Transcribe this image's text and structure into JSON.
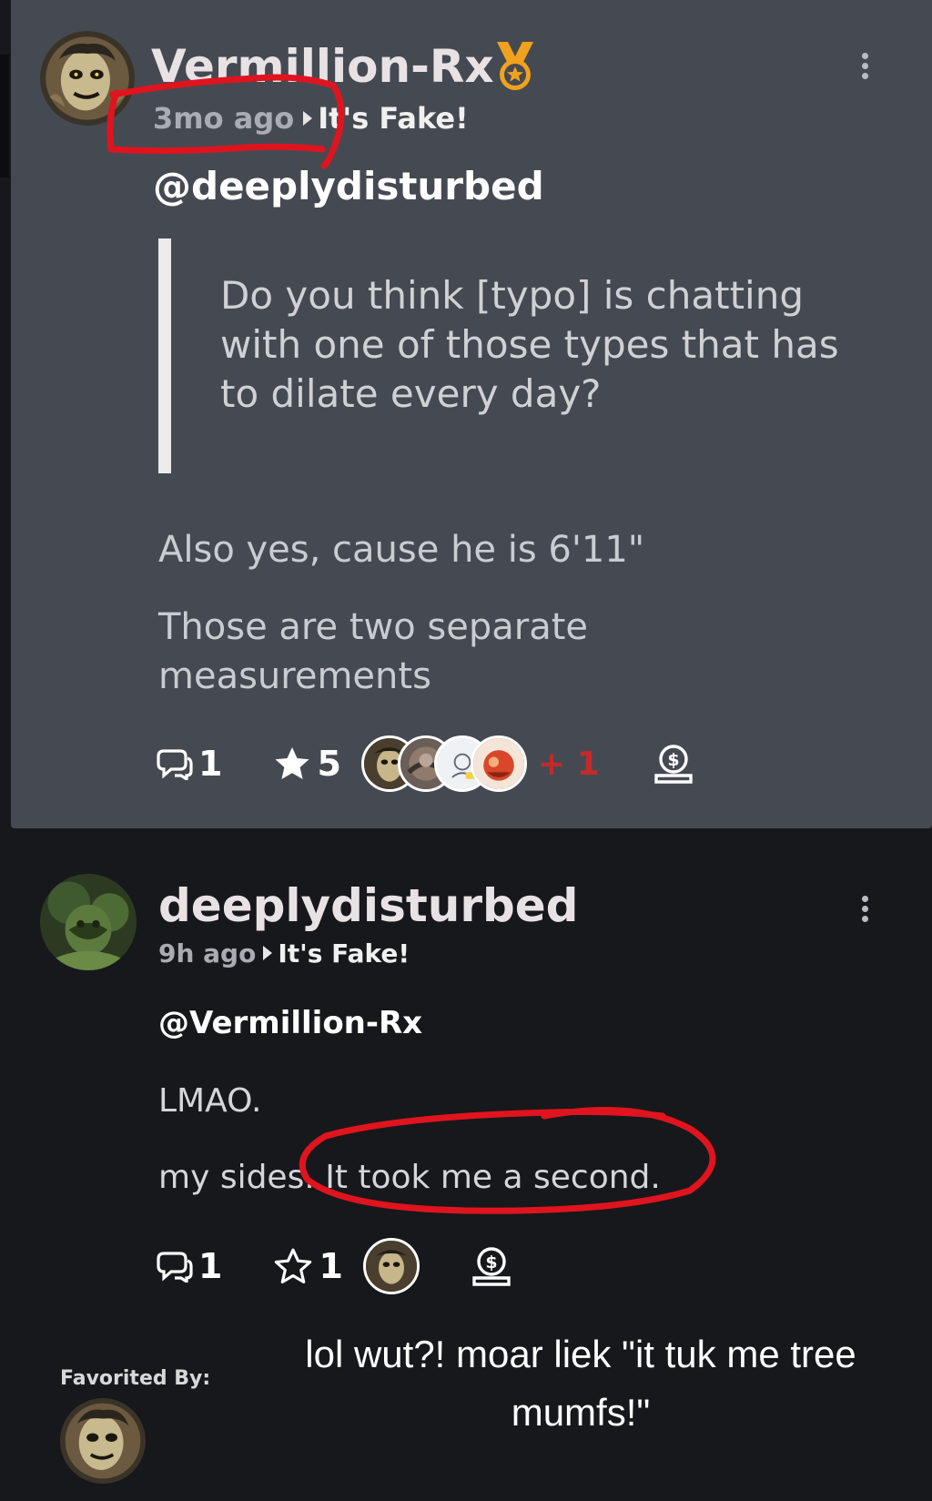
{
  "post1": {
    "username": "Vermillion-Rx",
    "badge_icon": "medal-icon",
    "time": "3mo ago",
    "channel": "It's Fake!",
    "mention": "@deeplydisturbed",
    "quote": "Do you think [typo] is chatting with one of those types that has to dilate every day?",
    "paragraph1": "Also yes, cause he is 6'11\"",
    "paragraph2": "Those are two separate measurements",
    "reply_count": "1",
    "favorite_count": "5",
    "more_favoriters": "+ 1"
  },
  "post2": {
    "username": "deeplydisturbed",
    "time": "9h ago",
    "channel": "It's Fake!",
    "mention": "@Vermillion-Rx",
    "paragraph1": "LMAO.",
    "paragraph2": "my sides. It took me a second.",
    "reply_count": "1",
    "favorite_count": "1"
  },
  "favorited_by_label": "Favorited By:",
  "caption": "lol wut?! moar liek \"it tuk me tree mumfs!\"",
  "colors": {
    "card1_bg": "#454a52",
    "card2_bg": "#17181b",
    "annotation_red": "#e0141e",
    "badge_gold": "#f0a21e",
    "plus_red": "#c42a2a"
  }
}
